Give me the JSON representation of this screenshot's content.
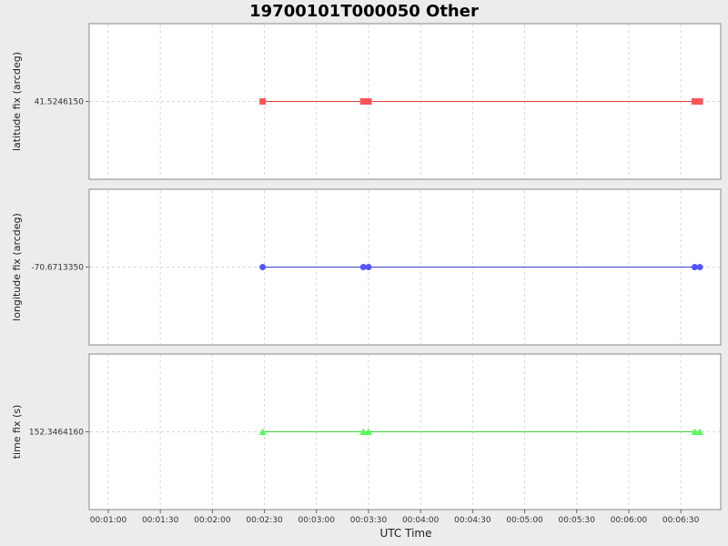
{
  "chart_data": {
    "type": "line",
    "title": "19700101T000050 Other",
    "xlabel": "UTC Time",
    "x_ticks": [
      "00:01:00",
      "00:01:30",
      "00:02:00",
      "00:02:30",
      "00:03:00",
      "00:03:30",
      "00:04:00",
      "00:04:30",
      "00:05:00",
      "00:05:30",
      "00:06:00",
      "00:06:30"
    ],
    "x_tick_seconds": [
      60,
      90,
      120,
      150,
      180,
      210,
      240,
      270,
      300,
      330,
      360,
      390
    ],
    "xlim_seconds": [
      49,
      413
    ],
    "x_seconds": [
      149,
      207,
      210,
      398,
      401
    ],
    "grid": true,
    "panels": [
      {
        "ylabel": "latitude fix (arcdeg)",
        "tick_label": "41.5246150",
        "marker": "square",
        "color": "#ff5555",
        "line_color": "#e04040",
        "values": [
          41.524615,
          41.524615,
          41.524615,
          41.524615,
          41.524615
        ]
      },
      {
        "ylabel": "longitude fix (arcdeg)",
        "tick_label": "-70.6713350",
        "marker": "circle",
        "color": "#5555ff",
        "line_color": "#4040d0",
        "values": [
          -70.671335,
          -70.671335,
          -70.671335,
          -70.671335,
          -70.671335
        ]
      },
      {
        "ylabel": "time fix (s)",
        "tick_label": "152.3464160",
        "marker": "triangle",
        "color": "#55ff55",
        "line_color": "#40d040",
        "values": [
          152.346416,
          152.346416,
          152.346416,
          152.346416,
          152.346416
        ]
      }
    ]
  }
}
